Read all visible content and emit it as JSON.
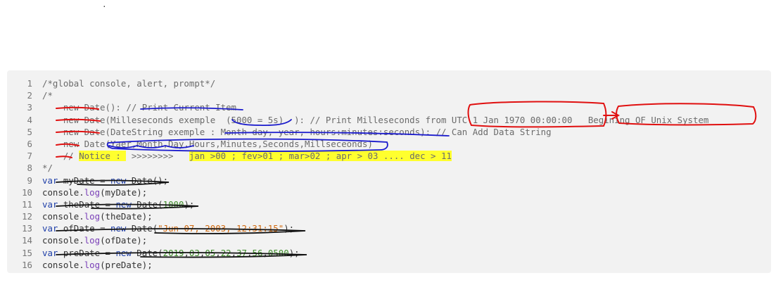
{
  "stray_mark": ".",
  "lines": [
    {
      "n": "1",
      "segs": [
        {
          "c": "cm",
          "t": "/*global console, alert, prompt*/"
        }
      ]
    },
    {
      "n": "2",
      "segs": [
        {
          "c": "cm",
          "t": "/*"
        }
      ]
    },
    {
      "n": "3",
      "segs": [
        {
          "c": "cm",
          "t": "    new Date(): // Print Current Item"
        }
      ]
    },
    {
      "n": "4",
      "segs": [
        {
          "c": "cm",
          "t": "    new Date(Milleseconds exemple  (5000 = 5s)  ): // Print Milleseconds from UTC 1 Jan 1970 00:00:00   Begining OF Unix System"
        }
      ]
    },
    {
      "n": "5",
      "segs": [
        {
          "c": "cm",
          "t": "    new Date(DateString exemple : Month day, year, hours:minutes:seconds): // Can Add Data String"
        }
      ]
    },
    {
      "n": "6",
      "segs": [
        {
          "c": "cm",
          "t": "    new Date(Yaer,Month,Day,Hours,Minutes,Seconds,Millseceonds)"
        }
      ]
    },
    {
      "n": "7",
      "segs": [
        {
          "c": "cm",
          "t": "    // "
        },
        {
          "c": "cm hl",
          "t": "Notice : "
        },
        {
          "c": "cm",
          "t": " >>>>>>>>   "
        },
        {
          "c": "cm hl",
          "t": "jan >00 ; fev>01 ; mar>02 ; apr > 03 .... dec > 11"
        }
      ]
    },
    {
      "n": "8",
      "segs": [
        {
          "c": "cm",
          "t": "*/"
        }
      ]
    },
    {
      "n": "9",
      "segs": [
        {
          "c": "kw",
          "t": "var"
        },
        {
          "c": "",
          "t": " myDate = "
        },
        {
          "c": "kw",
          "t": "new"
        },
        {
          "c": "",
          "t": " Date();"
        }
      ]
    },
    {
      "n": "10",
      "segs": [
        {
          "c": "",
          "t": "console."
        },
        {
          "c": "fn",
          "t": "log"
        },
        {
          "c": "",
          "t": "(myDate);"
        }
      ]
    },
    {
      "n": "11",
      "segs": [
        {
          "c": "kw",
          "t": "var"
        },
        {
          "c": "",
          "t": " theDate = "
        },
        {
          "c": "kw",
          "t": "new"
        },
        {
          "c": "",
          "t": " Date("
        },
        {
          "c": "num",
          "t": "1000"
        },
        {
          "c": "",
          "t": ");"
        }
      ]
    },
    {
      "n": "12",
      "segs": [
        {
          "c": "",
          "t": "console."
        },
        {
          "c": "fn",
          "t": "log"
        },
        {
          "c": "",
          "t": "(theDate);"
        }
      ]
    },
    {
      "n": "13",
      "segs": [
        {
          "c": "kw",
          "t": "var"
        },
        {
          "c": "",
          "t": " ofDate = "
        },
        {
          "c": "kw",
          "t": "new"
        },
        {
          "c": "",
          "t": " Date("
        },
        {
          "c": "str",
          "t": "\"Jun 07, 2003, 12:31:15\""
        },
        {
          "c": "",
          "t": ");"
        }
      ]
    },
    {
      "n": "14",
      "segs": [
        {
          "c": "",
          "t": "console."
        },
        {
          "c": "fn",
          "t": "log"
        },
        {
          "c": "",
          "t": "(ofDate);"
        }
      ]
    },
    {
      "n": "15",
      "segs": [
        {
          "c": "kw",
          "t": "var"
        },
        {
          "c": "",
          "t": " preDate = "
        },
        {
          "c": "kw",
          "t": "new"
        },
        {
          "c": "",
          "t": " Date("
        },
        {
          "c": "num",
          "t": "2019"
        },
        {
          "c": "",
          "t": ","
        },
        {
          "c": "num",
          "t": "03"
        },
        {
          "c": "",
          "t": ","
        },
        {
          "c": "num",
          "t": "05"
        },
        {
          "c": "",
          "t": ","
        },
        {
          "c": "num",
          "t": "22"
        },
        {
          "c": "",
          "t": ","
        },
        {
          "c": "num",
          "t": "37"
        },
        {
          "c": "",
          "t": ","
        },
        {
          "c": "num",
          "t": "56"
        },
        {
          "c": "",
          "t": ","
        },
        {
          "c": "num",
          "t": "0500"
        },
        {
          "c": "",
          "t": ");"
        }
      ]
    },
    {
      "n": "16",
      "segs": [
        {
          "c": "",
          "t": "console."
        },
        {
          "c": "fn",
          "t": "log"
        },
        {
          "c": "",
          "t": "(preDate);"
        }
      ]
    }
  ],
  "colors": {
    "comment": "#6b6b6b",
    "keyword": "#1f3fa8",
    "function": "#7a3fb8",
    "number": "#3e8c2a",
    "string": "#d06a10",
    "highlight": "#ffff2e",
    "annotation_red": "#e01010",
    "annotation_blue": "#1a1acc",
    "annotation_black": "#111111"
  }
}
